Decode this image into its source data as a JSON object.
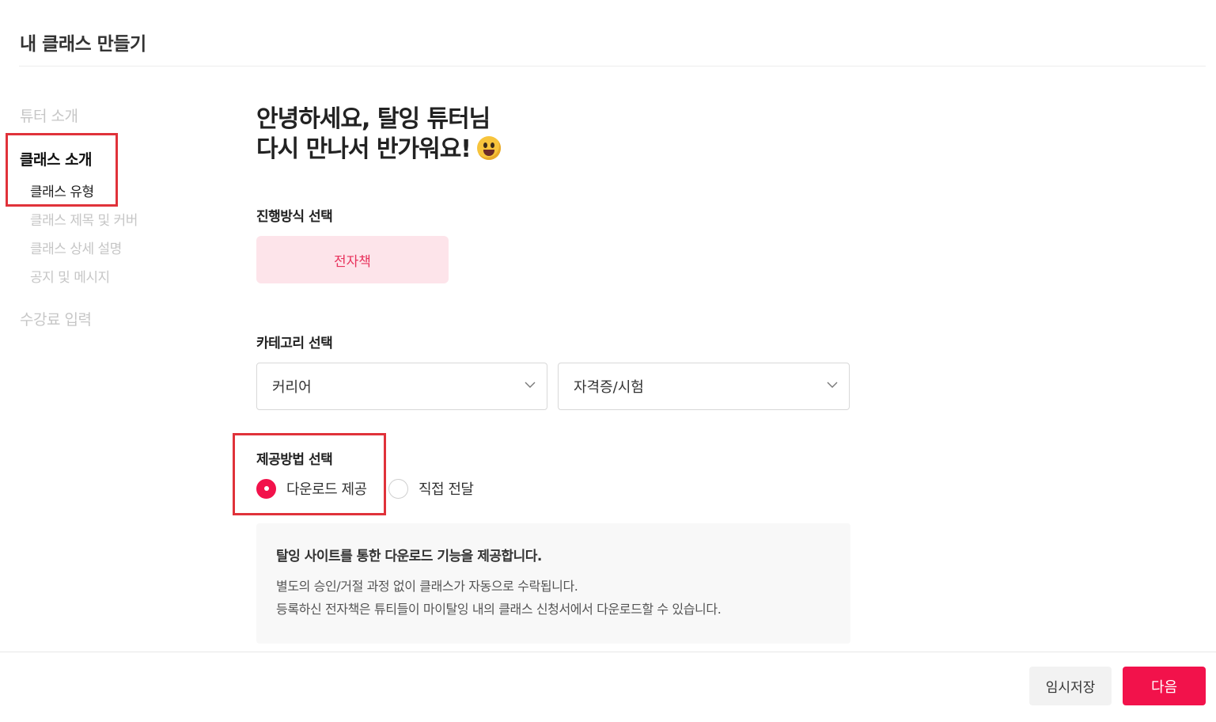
{
  "header": {
    "title": "내 클래스 만들기"
  },
  "sidebar": {
    "tutor_intro": "튜터 소개",
    "class_intro": "클래스 소개",
    "class_type": "클래스 유형",
    "class_title_cover": "클래스 제목 및 커버",
    "class_detail": "클래스 상세 설명",
    "notice_message": "공지 및 메시지",
    "fee_input": "수강료 입력"
  },
  "greeting": {
    "line1": "안녕하세요, 탈잉 튜터님",
    "line2": "다시 만나서 반가워요!"
  },
  "progress_method": {
    "label": "진행방식 선택",
    "selected": "전자책"
  },
  "category": {
    "label": "카테고리 선택",
    "primary": "커리어",
    "secondary": "자격증/시험"
  },
  "delivery": {
    "label": "제공방법 선택",
    "options": [
      "다운로드 제공",
      "직접 전달"
    ],
    "selected_index": 0
  },
  "info": {
    "title": "탈잉 사이트를 통한 다운로드 기능을 제공합니다.",
    "line1": "별도의 승인/거절 과정 없이 클래스가 자동으로 수락됩니다.",
    "line2": "등록하신 전자책은 튜티들이 마이탈잉 내의 클래스 신청서에서 다운로드할 수 있습니다."
  },
  "footer": {
    "save_label": "임시저장",
    "next_label": "다음"
  },
  "colors": {
    "accent": "#f2124b",
    "highlight_box": "#e0323a",
    "method_bg": "#fde4ea"
  }
}
